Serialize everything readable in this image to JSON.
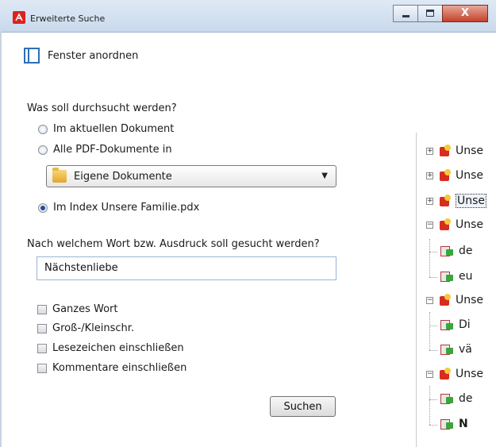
{
  "window": {
    "title": "Erweiterte Suche",
    "close_symbol": "X"
  },
  "arrange": {
    "label": "Fenster anordnen"
  },
  "scope": {
    "question": "Was soll durchsucht werden?",
    "options": [
      "Im aktuellen Dokument",
      "Alle PDF-Dokumente in",
      "Im Index Unsere Familie.pdx"
    ],
    "selected_index": 2,
    "folder_select": {
      "value": "Eigene Dokumente"
    }
  },
  "search": {
    "question": "Nach welchem Wort bzw. Ausdruck soll gesucht werden?",
    "value": "Nächstenliebe"
  },
  "options": {
    "checkboxes": [
      "Ganzes Wort",
      "Groß-/Kleinschr.",
      "Lesezeichen einschließen",
      "Kommentare einschließen"
    ]
  },
  "buttons": {
    "search_label": "Suchen"
  },
  "results": {
    "nodes": [
      {
        "type": "doc",
        "expander": "+",
        "text": "Unse"
      },
      {
        "type": "doc",
        "expander": "+",
        "text": "Unse"
      },
      {
        "type": "doc",
        "expander": "+",
        "text": "Unse",
        "selected": true
      },
      {
        "type": "doc",
        "expander": "−",
        "text": "Unse"
      },
      {
        "type": "hit",
        "text": "de"
      },
      {
        "type": "hit",
        "text": "eu"
      },
      {
        "type": "doc",
        "expander": "−",
        "text": "Unse"
      },
      {
        "type": "hit",
        "text": "Di"
      },
      {
        "type": "hit",
        "text": "vä"
      },
      {
        "type": "doc",
        "expander": "−",
        "text": "Unse"
      },
      {
        "type": "hit",
        "text": "de"
      },
      {
        "type": "hit",
        "text": "N",
        "bold": true
      }
    ]
  }
}
